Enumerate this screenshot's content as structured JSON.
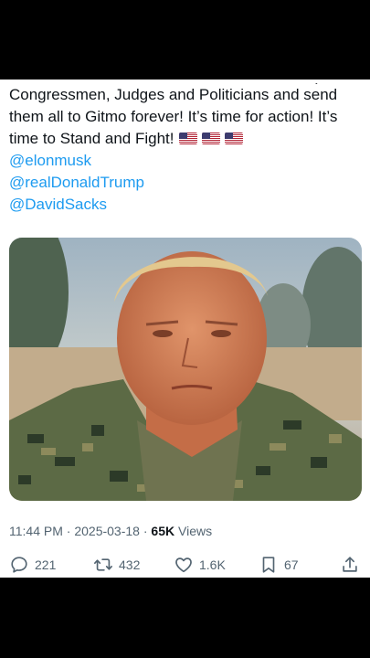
{
  "tweet": {
    "text_lines": [
      "Congressmen, Judges and Politicians and send",
      "them all to Gitmo forever! It’s time for action! It’s",
      "time to Stand and Fight!"
    ],
    "flag_icons": [
      "us-flag-icon",
      "us-flag-icon",
      "us-flag-icon"
    ],
    "mentions": [
      "@elonmusk",
      "@realDonaldTrump",
      "@DavidSacks"
    ]
  },
  "meta": {
    "time": "11:44 PM",
    "date": "2025-03-18",
    "separator": "·",
    "views_count": "65K",
    "views_label": "Views"
  },
  "actions": {
    "reply": {
      "icon": "reply-icon",
      "count": "221"
    },
    "retweet": {
      "icon": "retweet-icon",
      "count": "432"
    },
    "like": {
      "icon": "heart-icon",
      "count": "1.6K"
    },
    "bookmark": {
      "icon": "bookmark-icon",
      "count": "67"
    },
    "share": {
      "icon": "share-icon"
    }
  },
  "colors": {
    "text": "#0f1419",
    "secondary": "#536471",
    "link": "#1d9bf0",
    "background": "#ffffff"
  }
}
